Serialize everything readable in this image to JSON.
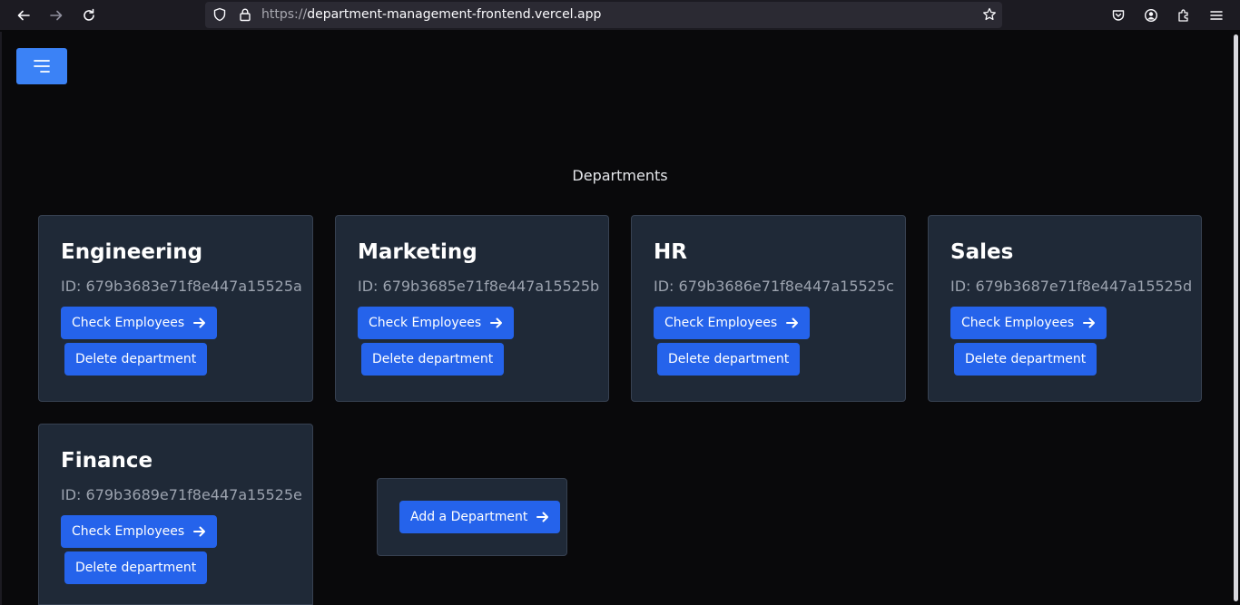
{
  "browser": {
    "url_protocol": "https://",
    "url_host": "department-management-frontend.vercel.app"
  },
  "page": {
    "title": "Departments"
  },
  "departments": [
    {
      "name": "Engineering",
      "id_text": "ID: 679b3683e71f8e447a15525a",
      "check_label": "Check Employees",
      "delete_label": "Delete department"
    },
    {
      "name": "Marketing",
      "id_text": "ID: 679b3685e71f8e447a15525b",
      "check_label": "Check Employees",
      "delete_label": "Delete department"
    },
    {
      "name": "HR",
      "id_text": "ID: 679b3686e71f8e447a15525c",
      "check_label": "Check Employees",
      "delete_label": "Delete department"
    },
    {
      "name": "Sales",
      "id_text": "ID: 679b3687e71f8e447a15525d",
      "check_label": "Check Employees",
      "delete_label": "Delete department"
    },
    {
      "name": "Finance",
      "id_text": "ID: 679b3689e71f8e447a15525e",
      "check_label": "Check Employees",
      "delete_label": "Delete department"
    }
  ],
  "add_department": {
    "label": "Add a Department"
  },
  "colors": {
    "accent": "#2563eb",
    "menu_button": "#3b82f6",
    "card_bg": "#1f2937",
    "page_bg": "#09090b"
  }
}
